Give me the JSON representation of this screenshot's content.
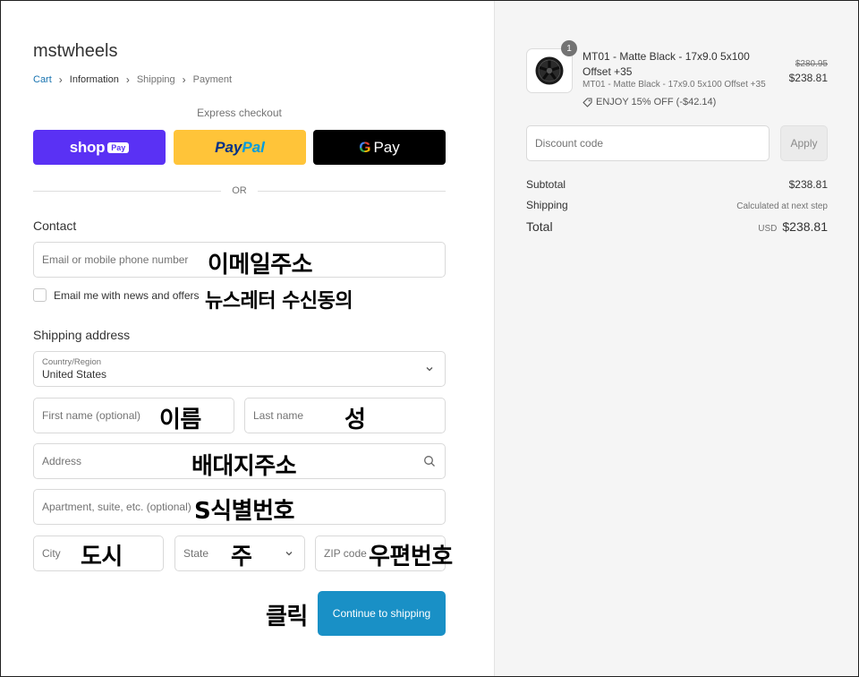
{
  "store": {
    "name": "mstwheels"
  },
  "breadcrumb": [
    {
      "label": "Cart"
    },
    {
      "label": "Information"
    },
    {
      "label": "Shipping"
    },
    {
      "label": "Payment"
    }
  ],
  "express": {
    "label": "Express checkout",
    "shop_pay": {
      "word": "shop",
      "pill": "Pay"
    },
    "paypal": {
      "part1": "Pay",
      "part2": "Pal"
    },
    "gpay": {
      "g": "G",
      "word": "Pay"
    },
    "or": "OR"
  },
  "contact": {
    "title": "Contact",
    "email_placeholder": "Email or mobile phone number",
    "email_annotation": "이메일주소",
    "newsletter_label": "Email me with news and offers",
    "newsletter_checked": false,
    "newsletter_annotation": "뉴스레터 수신동의"
  },
  "shipping": {
    "title": "Shipping address",
    "country_label": "Country/Region",
    "country_value": "United States",
    "first_name_placeholder": "First name (optional)",
    "first_name_annotation": "이름",
    "last_name_placeholder": "Last name",
    "last_name_annotation": "성",
    "address_placeholder": "Address",
    "address_annotation": "배대지주소",
    "apartment_placeholder": "Apartment, suite, etc. (optional)",
    "apartment_annotation": "S식별번호",
    "city_placeholder": "City",
    "city_annotation": "도시",
    "state_placeholder": "State",
    "state_annotation": "주",
    "zip_placeholder": "ZIP code",
    "zip_annotation": "우편번호"
  },
  "actions": {
    "click_annotation": "클릭",
    "continue_label": "Continue to shipping"
  },
  "order": {
    "quantity": "1",
    "product_name": "MT01 - Matte Black - 17x9.0 5x100 Offset +35",
    "product_variant": "MT01 - Matte Black - 17x9.0 5x100 Offset +35",
    "discount_text": "ENJOY 15% OFF (-$42.14)",
    "price_original": "$280.95",
    "price_current": "$238.81",
    "discount_placeholder": "Discount code",
    "apply_label": "Apply",
    "subtotal_label": "Subtotal",
    "subtotal_value": "$238.81",
    "shipping_label": "Shipping",
    "shipping_value": "Calculated at next step",
    "total_label": "Total",
    "total_currency": "USD",
    "total_value": "$238.81"
  },
  "colors": {
    "shop_pay": "#5a31f4",
    "paypal": "#ffc439",
    "gpay": "#000000",
    "continue": "#1990c6",
    "link": "#1773b0"
  }
}
